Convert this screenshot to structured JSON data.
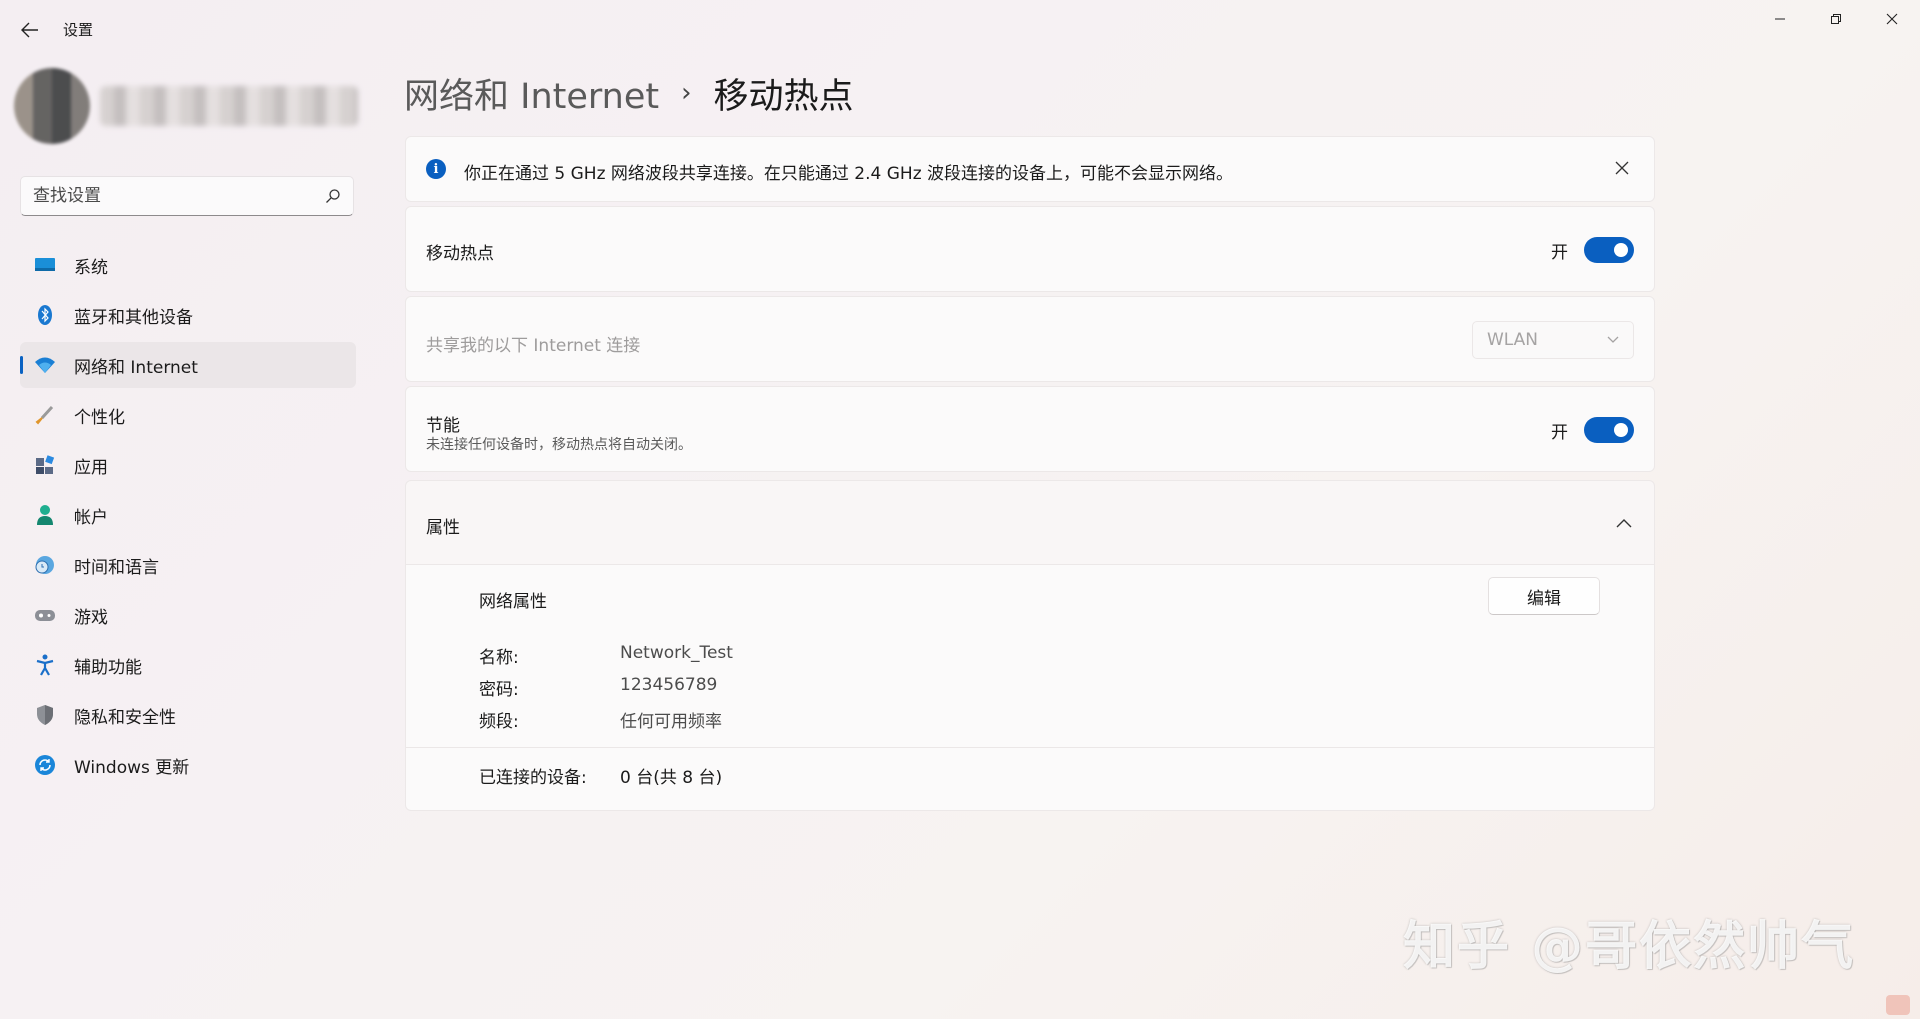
{
  "titlebar": {
    "app_title": "设置"
  },
  "sidebar": {
    "search_placeholder": "查找设置",
    "items": [
      {
        "label": "系统",
        "icon": "monitor-icon",
        "active": false
      },
      {
        "label": "蓝牙和其他设备",
        "icon": "bluetooth-icon",
        "active": false
      },
      {
        "label": "网络和 Internet",
        "icon": "wifi-icon",
        "active": true
      },
      {
        "label": "个性化",
        "icon": "brush-icon",
        "active": false
      },
      {
        "label": "应用",
        "icon": "apps-icon",
        "active": false
      },
      {
        "label": "帐户",
        "icon": "person-icon",
        "active": false
      },
      {
        "label": "时间和语言",
        "icon": "clock-globe-icon",
        "active": false
      },
      {
        "label": "游戏",
        "icon": "gamepad-icon",
        "active": false
      },
      {
        "label": "辅助功能",
        "icon": "accessibility-icon",
        "active": false
      },
      {
        "label": "隐私和安全性",
        "icon": "shield-icon",
        "active": false
      },
      {
        "label": "Windows 更新",
        "icon": "update-icon",
        "active": false
      }
    ]
  },
  "main": {
    "breadcrumb_parent": "网络和 Internet",
    "breadcrumb_sep": "›",
    "breadcrumb_current": "移动热点",
    "info_text": "你正在通过 5 GHz 网络波段共享连接。在只能通过 2.4 GHz 波段连接的设备上，可能不会显示网络。",
    "hotspot": {
      "label": "移动热点",
      "state": "开",
      "on": true
    },
    "share": {
      "label": "共享我的以下 Internet 连接",
      "value": "WLAN"
    },
    "power_saving": {
      "label": "节能",
      "desc": "未连接任何设备时，移动热点将自动关闭。",
      "state": "开",
      "on": true
    },
    "properties": {
      "header": "属性",
      "section_title": "网络属性",
      "edit_label": "编辑",
      "name_key": "名称:",
      "name_value": "Network_Test",
      "password_key": "密码:",
      "password_value": "123456789",
      "band_key": "频段:",
      "band_value": "任何可用频率",
      "devices_key": "已连接的设备:",
      "devices_value": "0 台(共 8 台)"
    }
  },
  "watermark": "知乎 @哥依然帅气",
  "colors": {
    "accent": "#0a5fc0"
  }
}
